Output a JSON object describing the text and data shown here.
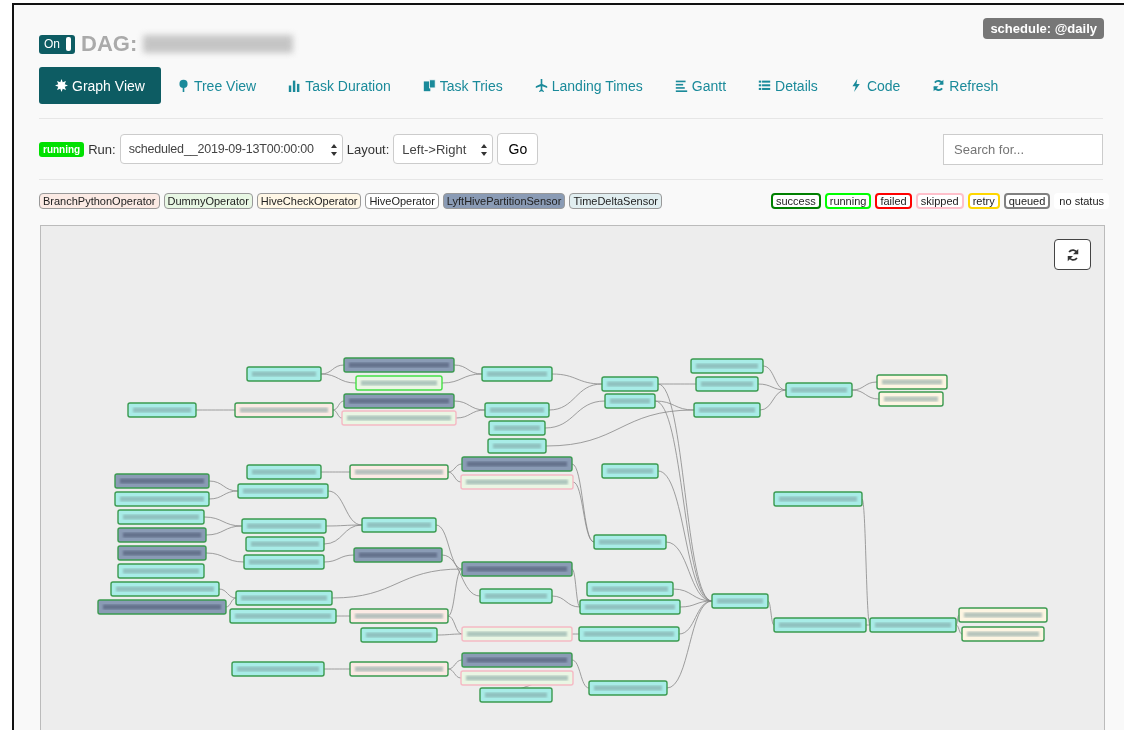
{
  "header": {
    "toggle": {
      "label": "On",
      "on": true
    },
    "title_prefix": "DAG:",
    "schedule": "schedule: @daily"
  },
  "nav": [
    {
      "label": "Graph View",
      "kind": "graph",
      "selected": true
    },
    {
      "label": "Tree View",
      "kind": "tree",
      "selected": false
    },
    {
      "label": "Task Duration",
      "kind": "duration",
      "selected": false
    },
    {
      "label": "Task Tries",
      "kind": "tries",
      "selected": false
    },
    {
      "label": "Landing Times",
      "kind": "landing",
      "selected": false
    },
    {
      "label": "Gantt",
      "kind": "gantt",
      "selected": false
    },
    {
      "label": "Details",
      "kind": "details",
      "selected": false
    },
    {
      "label": "Code",
      "kind": "code",
      "selected": false
    },
    {
      "label": "Refresh",
      "kind": "refresh",
      "selected": false
    }
  ],
  "run_bar": {
    "status": "running",
    "color": "#00e000",
    "run_label": "Run:",
    "run_value": "scheduled__2019-09-13T00:00:00",
    "layout_label": "Layout:",
    "layout_value": "Left->Right",
    "go": "Go",
    "search": {
      "placeholder": "Search for..."
    }
  },
  "operators": [
    {
      "label": "BranchPythonOperator",
      "color": "#fbeae4"
    },
    {
      "label": "DummyOperator",
      "color": "#e8f7e4"
    },
    {
      "label": "HiveCheckOperator",
      "color": "#fff7e6"
    },
    {
      "label": "HiveOperator",
      "color": "#ffffff"
    },
    {
      "label": "LyftHivePartitionSensor",
      "color": "#8a9bb5"
    },
    {
      "label": "TimeDeltaSensor",
      "color": "#e1eef0"
    }
  ],
  "states": [
    {
      "label": "success",
      "color": "#008000"
    },
    {
      "label": "running",
      "color": "#00ff00"
    },
    {
      "label": "failed",
      "color": "#ff0000"
    },
    {
      "label": "skipped",
      "color": "#ffc0cb"
    },
    {
      "label": "retry",
      "color": "#ffd700"
    },
    {
      "label": "queued",
      "color": "#808080"
    },
    {
      "label": "no status",
      "color": "#ffffff"
    }
  ],
  "graph": {
    "nodes": [
      {
        "kind": "task",
        "running": false,
        "skipped": false
      },
      {
        "kind": "sensor",
        "running": false,
        "skipped": false
      },
      {
        "kind": "dummy",
        "running": true,
        "skipped": false
      },
      {
        "kind": "task",
        "running": false,
        "skipped": false
      },
      {
        "kind": "task",
        "running": false,
        "skipped": false
      },
      {
        "kind": "branch",
        "running": false,
        "skipped": false
      },
      {
        "kind": "sensor",
        "running": false,
        "skipped": false
      },
      {
        "kind": "dummy",
        "running": false,
        "skipped": true
      },
      {
        "kind": "task",
        "running": false,
        "skipped": false
      },
      {
        "kind": "task",
        "running": false,
        "skipped": false
      },
      {
        "kind": "task",
        "running": false,
        "skipped": false
      },
      {
        "kind": "task",
        "running": false,
        "skipped": false
      },
      {
        "kind": "task",
        "running": false,
        "skipped": false
      },
      {
        "kind": "task",
        "running": false,
        "skipped": false
      },
      {
        "kind": "task",
        "running": false,
        "skipped": false
      },
      {
        "kind": "task",
        "running": false,
        "skipped": false
      },
      {
        "kind": "task",
        "running": false,
        "skipped": false
      },
      {
        "kind": "check",
        "running": false,
        "skipped": false
      },
      {
        "kind": "check",
        "running": false,
        "skipped": false
      },
      {
        "kind": "task",
        "running": false,
        "skipped": false
      },
      {
        "kind": "task",
        "running": false,
        "skipped": false
      },
      {
        "kind": "branch",
        "running": false,
        "skipped": false
      },
      {
        "kind": "sensor",
        "running": false,
        "skipped": false
      },
      {
        "kind": "dummy",
        "running": false,
        "skipped": true
      },
      {
        "kind": "sensor",
        "running": false,
        "skipped": false
      },
      {
        "kind": "task",
        "running": false,
        "skipped": false
      },
      {
        "kind": "task",
        "running": false,
        "skipped": false
      },
      {
        "kind": "task",
        "running": false,
        "skipped": false
      },
      {
        "kind": "sensor",
        "running": false,
        "skipped": false
      },
      {
        "kind": "task",
        "running": false,
        "skipped": false
      },
      {
        "kind": "task",
        "running": false,
        "skipped": false
      },
      {
        "kind": "task",
        "running": false,
        "skipped": false
      },
      {
        "kind": "sensor",
        "running": false,
        "skipped": false
      },
      {
        "kind": "sensor",
        "running": false,
        "skipped": false
      },
      {
        "kind": "task",
        "running": false,
        "skipped": false
      },
      {
        "kind": "task",
        "running": false,
        "skipped": false
      },
      {
        "kind": "task",
        "running": false,
        "skipped": false
      },
      {
        "kind": "task",
        "running": false,
        "skipped": false
      },
      {
        "kind": "task",
        "running": false,
        "skipped": false
      },
      {
        "kind": "sensor",
        "running": false,
        "skipped": false
      },
      {
        "kind": "task",
        "running": false,
        "skipped": false
      },
      {
        "kind": "task",
        "running": false,
        "skipped": false
      },
      {
        "kind": "sensor",
        "running": false,
        "skipped": false
      },
      {
        "kind": "task",
        "running": false,
        "skipped": false
      },
      {
        "kind": "task",
        "running": false,
        "skipped": false
      },
      {
        "kind": "task",
        "running": false,
        "skipped": false
      },
      {
        "kind": "branch",
        "running": false,
        "skipped": false
      },
      {
        "kind": "task",
        "running": false,
        "skipped": false
      },
      {
        "kind": "dummy",
        "running": false,
        "skipped": true
      },
      {
        "kind": "task",
        "running": false,
        "skipped": false
      },
      {
        "kind": "task",
        "running": false,
        "skipped": false
      },
      {
        "kind": "task",
        "running": false,
        "skipped": false
      },
      {
        "kind": "task",
        "running": false,
        "skipped": false
      },
      {
        "kind": "check",
        "running": false,
        "skipped": false
      },
      {
        "kind": "check",
        "running": false,
        "skipped": false
      },
      {
        "kind": "task",
        "running": false,
        "skipped": false
      },
      {
        "kind": "branch",
        "running": false,
        "skipped": false
      },
      {
        "kind": "sensor",
        "running": false,
        "skipped": false
      },
      {
        "kind": "dummy",
        "running": false,
        "skipped": true
      },
      {
        "kind": "task",
        "running": false,
        "skipped": false
      },
      {
        "kind": "task",
        "running": false,
        "skipped": false
      }
    ]
  }
}
